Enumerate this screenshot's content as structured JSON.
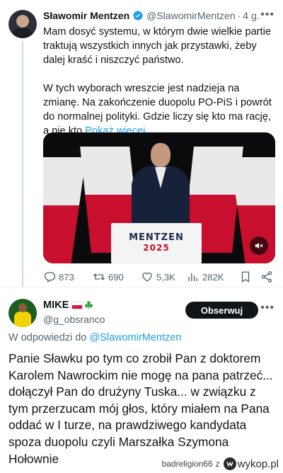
{
  "tweet": {
    "author_name": "Sławomir Mentzen",
    "handle": "@SlawomirMentzen",
    "separator": "·",
    "time": "4 g.",
    "paragraphs": [
      "Mam dosyć systemu, w którym dwie wielkie partie traktują wszystkich innych jak przystawki, żeby dalej kraść i niszczyć państwo.",
      "W tych wyborach wreszcie jest nadzieja na zmianę. Na zakończenie duopolu PO-PiS i powrót do normalnej polityki. Gdzie liczy się kto ma rację, a nie kto "
    ],
    "show_more": "Pokaż więcej",
    "media": {
      "podium_line1": "MENTZEN",
      "podium_line2": "2025"
    },
    "actions": {
      "replies": "873",
      "reposts": "690",
      "likes": "5,3K",
      "views": "282K"
    }
  },
  "reply": {
    "author_name": "MIKE",
    "handle": "@g_obsranco",
    "follow_label": "Obserwuj",
    "reply_to_prefix": "W odpowiedzi do ",
    "reply_to_mention": "@SlawomirMentzen",
    "text": "Panie Sławku po tym co zrobił Pan z doktorem Karolem Nawrockim nie mogę na pana patrzeć... dołączył Pan do drużyny Tuska... w związku z tym przerzucam mój głos, który miałem na Pana oddać w I turze, na prawdziwego kandydata spoza duopolu czyli Marszałka Szymona Hołownie"
  },
  "footer": {
    "user": "badreligion66",
    "z": "z",
    "site": "wykop.pl"
  },
  "colors": {
    "link": "#1d9bf0",
    "muted": "#536471",
    "text": "#0f1419",
    "follow_bg": "#0f1419"
  },
  "icons": [
    "verified-icon",
    "more-icon",
    "reply-icon",
    "repost-icon",
    "like-icon",
    "views-icon",
    "bookmark-icon",
    "share-icon",
    "mute-icon",
    "wykop-logo"
  ]
}
